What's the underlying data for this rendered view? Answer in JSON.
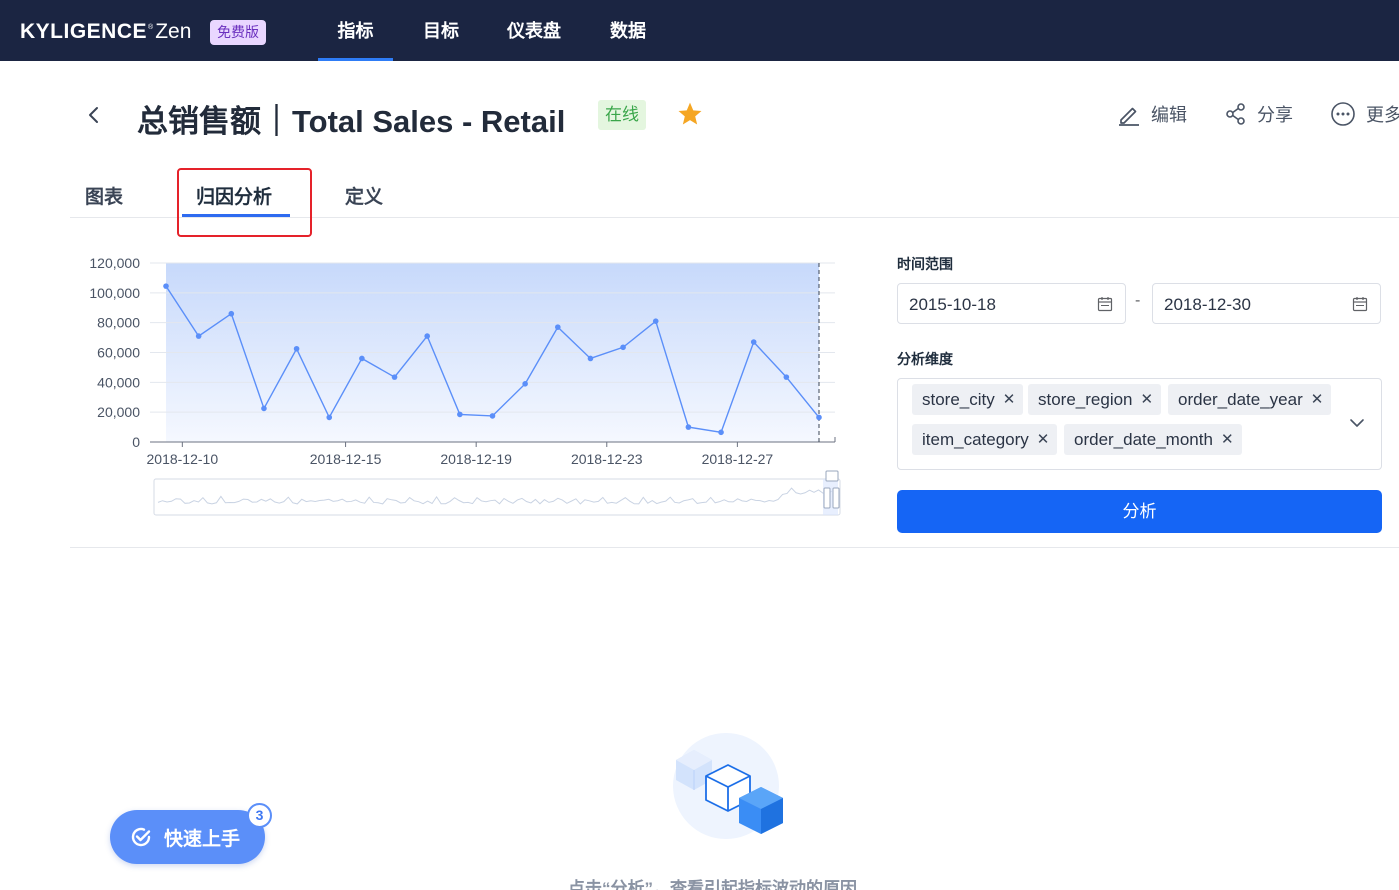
{
  "topbar": {
    "brand": "KYLIGENCE",
    "brand_mark": "®",
    "brand_suffix": "Zen",
    "edition_badge": "免费版",
    "nav": [
      "指标",
      "目标",
      "仪表盘",
      "数据"
    ]
  },
  "header": {
    "title": "总销售额｜Total Sales - Retail",
    "status": "在线",
    "actions": {
      "edit": "编辑",
      "share": "分享",
      "more": "更多"
    }
  },
  "tabs": [
    "图表",
    "归因分析",
    "定义"
  ],
  "active_tab": "归因分析",
  "chart_data": {
    "type": "area",
    "x": [
      "2018-12-09",
      "2018-12-10",
      "2018-12-11",
      "2018-12-12",
      "2018-12-13",
      "2018-12-14",
      "2018-12-15",
      "2018-12-16",
      "2018-12-17",
      "2018-12-18",
      "2018-12-19",
      "2018-12-20",
      "2018-12-21",
      "2018-12-22",
      "2018-12-23",
      "2018-12-24",
      "2018-12-25",
      "2018-12-26",
      "2018-12-27",
      "2018-12-28",
      "2018-12-29"
    ],
    "y": [
      104500,
      71000,
      86000,
      22500,
      62500,
      16500,
      56000,
      43500,
      71000,
      18500,
      17500,
      39000,
      77000,
      56000,
      63500,
      81000,
      10000,
      6500,
      67000,
      43500,
      16500
    ],
    "xticks": [
      "2018-12-10",
      "2018-12-15",
      "2018-12-19",
      "2018-12-23",
      "2018-12-27"
    ],
    "yticks": [
      "120,000",
      "100,000",
      "80,000",
      "60,000",
      "40,000",
      "20,000",
      "0"
    ],
    "ylim": [
      0,
      120000
    ],
    "grid": true,
    "series_color": "#5b8ff9",
    "area_color": "#c7d9fb"
  },
  "panel": {
    "time_range_label": "时间范围",
    "start_date": "2015-10-18",
    "end_date": "2018-12-30",
    "date_separator": "-",
    "dimension_label": "分析维度",
    "dimensions": [
      "store_city",
      "store_region",
      "order_date_year",
      "item_category",
      "order_date_month"
    ],
    "analyze_button": "分析"
  },
  "empty_state": {
    "hint": "点击“分析”，查看引起指标波动的原因"
  },
  "quick_start": {
    "label": "快速上手",
    "count": "3"
  },
  "colors": {
    "nav_bg": "#1b2542",
    "accent": "#1565f5",
    "status_green": "#3aa64a",
    "star": "#f5a623",
    "highlight_red": "#e5222a"
  }
}
